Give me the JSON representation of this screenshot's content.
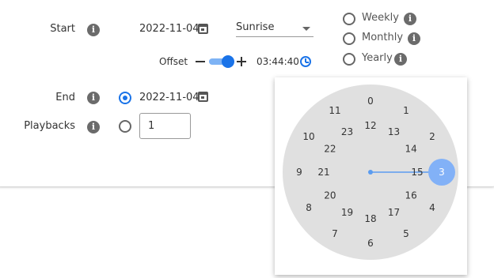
{
  "start": {
    "label": "Start",
    "date": "2022-11-04",
    "event_select": "Sunrise",
    "offset_label": "Offset",
    "offset_time": "03:44:40"
  },
  "end": {
    "label": "End",
    "date": "2022-11-04"
  },
  "playbacks": {
    "label": "Playbacks",
    "value": "1"
  },
  "recurrence": {
    "options": [
      "Weekly",
      "Monthly",
      "Yearly"
    ]
  },
  "clock": {
    "outer_hours": [
      "0",
      "1",
      "2",
      "3",
      "4",
      "5",
      "6",
      "7",
      "8",
      "9",
      "10",
      "11"
    ],
    "inner_hours": [
      "12",
      "13",
      "14",
      "15",
      "16",
      "17",
      "18",
      "19",
      "20",
      "21",
      "22",
      "23"
    ],
    "selected_hour": "3",
    "colors": {
      "face": "#e0e0e0",
      "accent": "#82b1f7",
      "hand": "#5b9cf0"
    }
  }
}
